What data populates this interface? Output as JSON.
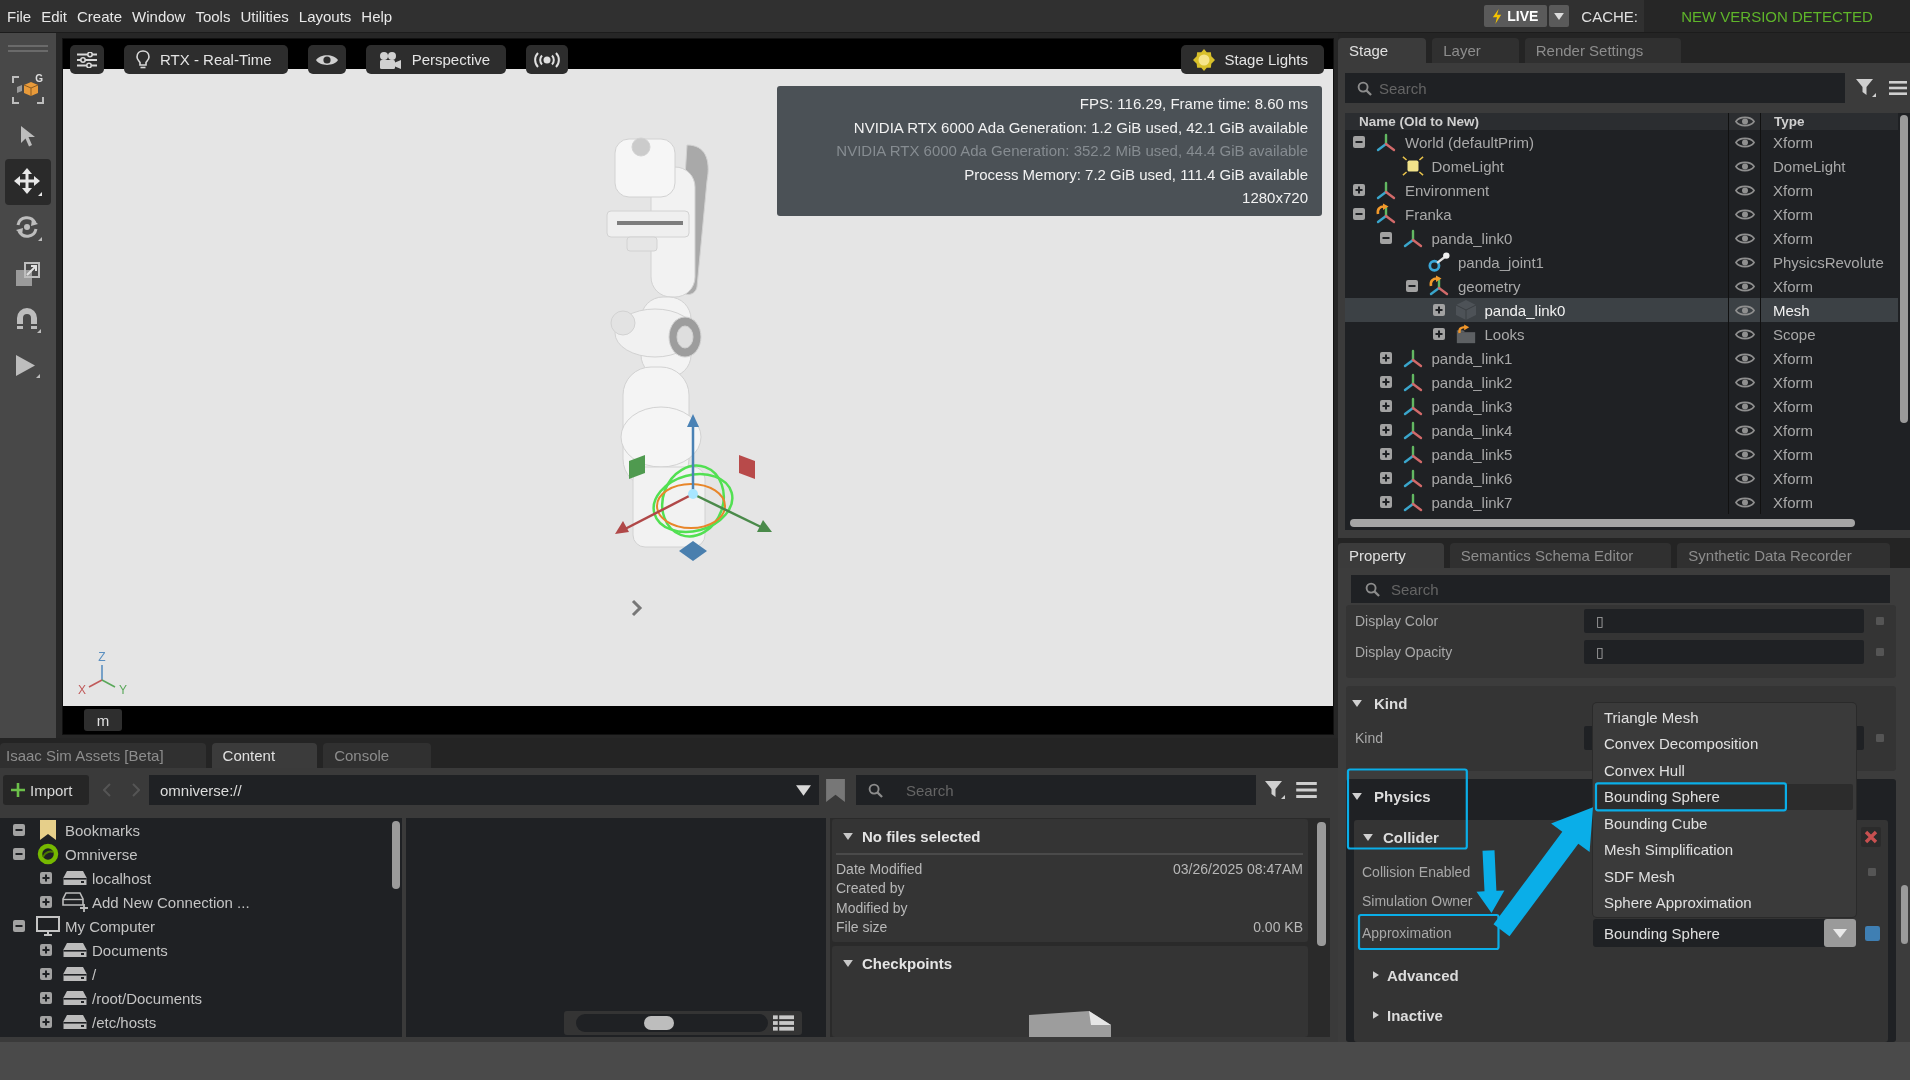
{
  "menu_bar": {
    "items": [
      "File",
      "Edit",
      "Create",
      "Window",
      "Tools",
      "Utilities",
      "Layouts",
      "Help"
    ],
    "live_label": "LIVE",
    "cache_label": "CACHE:",
    "cache_status": "NEW VERSION DETECTED"
  },
  "left_toolbar": {
    "tools": [
      {
        "kind": "select-mode",
        "letter": "G",
        "selected": false
      },
      {
        "kind": "pointer",
        "selected": false
      },
      {
        "kind": "move",
        "selected": true
      },
      {
        "kind": "rotate",
        "selected": false
      },
      {
        "kind": "scale",
        "selected": false
      },
      {
        "kind": "snap",
        "selected": false
      },
      {
        "kind": "play",
        "selected": false
      }
    ]
  },
  "viewport": {
    "toolbar": [
      {
        "kind": "settings"
      },
      {
        "kind": "renderer",
        "label": "RTX - Real-Time"
      },
      {
        "kind": "visibility"
      },
      {
        "kind": "camera",
        "label": "Perspective"
      },
      {
        "kind": "broadcast"
      },
      {
        "kind": "lights",
        "label": "Stage Lights"
      }
    ],
    "stats": [
      {
        "text": "FPS: 116.29, Frame time: 8.60 ms",
        "dimmed": false
      },
      {
        "text": "NVIDIA RTX 6000 Ada Generation: 1.2 GiB used, 42.1 GiB available",
        "dimmed": false
      },
      {
        "text": "NVIDIA RTX 6000 Ada Generation: 352.2 MiB used, 44.4 GiB available",
        "dimmed": true
      },
      {
        "text": "Process Memory: 7.2 GiB used, 111.4 GiB available",
        "dimmed": false
      },
      {
        "text": "1280x720",
        "dimmed": false
      }
    ],
    "axis_labels": [
      "Z",
      "X",
      "Y"
    ],
    "units": "m"
  },
  "stage_panel": {
    "tabs": [
      {
        "label": "Stage",
        "selected": true
      },
      {
        "label": "Layer",
        "selected": false
      },
      {
        "label": "Render Settings",
        "selected": false
      }
    ],
    "search": {
      "placeholder": "Search"
    },
    "columns": {
      "name": "Name (Old to New)",
      "type": "Type"
    },
    "tree": [
      {
        "name": "World (defaultPrim)",
        "type": "Xform",
        "kind": "xform",
        "expanded": true,
        "selected": false,
        "children": [
          {
            "name": "DomeLight",
            "type": "DomeLight",
            "kind": "light",
            "selected": false
          }
        ]
      },
      {
        "name": "Environment",
        "type": "Xform",
        "kind": "xform",
        "expanded": false,
        "selected": false
      },
      {
        "name": "Franka",
        "type": "Xform",
        "kind": "xform-ref",
        "expanded": true,
        "selected": false,
        "children": [
          {
            "name": "panda_link0",
            "type": "Xform",
            "kind": "xform",
            "expanded": true,
            "selected": false,
            "children": [
              {
                "name": "panda_joint1",
                "type": "PhysicsRevolute",
                "kind": "joint",
                "selected": false
              },
              {
                "name": "geometry",
                "type": "Xform",
                "kind": "xform-ref",
                "expanded": true,
                "selected": false,
                "children": [
                  {
                    "name": "panda_link0",
                    "type": "Mesh",
                    "kind": "mesh",
                    "expanded": false,
                    "selected": true
                  },
                  {
                    "name": "Looks",
                    "type": "Scope",
                    "kind": "scope-ref",
                    "expanded": false,
                    "selected": false
                  }
                ]
              }
            ]
          },
          {
            "name": "panda_link1",
            "type": "Xform",
            "kind": "xform",
            "expanded": false,
            "selected": false
          },
          {
            "name": "panda_link2",
            "type": "Xform",
            "kind": "xform",
            "expanded": false,
            "selected": false
          },
          {
            "name": "panda_link3",
            "type": "Xform",
            "kind": "xform",
            "expanded": false,
            "selected": false
          },
          {
            "name": "panda_link4",
            "type": "Xform",
            "kind": "xform",
            "expanded": false,
            "selected": false
          },
          {
            "name": "panda_link5",
            "type": "Xform",
            "kind": "xform",
            "expanded": false,
            "selected": false
          },
          {
            "name": "panda_link6",
            "type": "Xform",
            "kind": "xform",
            "expanded": false,
            "selected": false
          },
          {
            "name": "panda_link7",
            "type": "Xform",
            "kind": "xform",
            "expanded": false,
            "selected": false
          }
        ]
      }
    ]
  },
  "property_panel": {
    "tabs": [
      {
        "label": "Property",
        "selected": true
      },
      {
        "label": "Semantics Schema Editor",
        "selected": false
      },
      {
        "label": "Synthetic Data Recorder",
        "selected": false
      }
    ],
    "search": {
      "placeholder": "Search"
    },
    "rows": [
      {
        "label": "Display Color",
        "kind": "field",
        "value": "▯",
        "modified": false
      },
      {
        "label": "Display Opacity",
        "kind": "field",
        "value": "▯",
        "modified": false
      }
    ],
    "sections": [
      {
        "title": "Kind",
        "expanded": true,
        "highlighted": false,
        "rows": [
          {
            "label": "Kind",
            "kind": "field",
            "modified": false
          }
        ]
      },
      {
        "title": "Physics",
        "expanded": true,
        "highlighted": true,
        "subsections": [
          {
            "title": "Collider",
            "expanded": true,
            "highlighted": true,
            "removable": true,
            "rows": [
              {
                "label": "Collision Enabled",
                "highlighted": false,
                "modified": false
              },
              {
                "label": "Simulation Owner",
                "highlighted": false
              },
              {
                "label": "Approximation",
                "kind": "dropdown",
                "value": "Bounding Sphere",
                "highlighted": true,
                "modified": true
              }
            ],
            "subsections": [
              {
                "title": "Advanced",
                "expanded": false,
                "highlighted": false
              },
              {
                "title": "Inactive",
                "expanded": false,
                "highlighted": false
              }
            ]
          }
        ]
      }
    ],
    "dropdown_menu": {
      "options": [
        {
          "label": "Triangle Mesh",
          "selected": false,
          "highlighted": false
        },
        {
          "label": "Convex Decomposition",
          "selected": false,
          "highlighted": false
        },
        {
          "label": "Convex Hull",
          "selected": false,
          "highlighted": false
        },
        {
          "label": "Bounding Sphere",
          "selected": true,
          "highlighted": true
        },
        {
          "label": "Bounding Cube",
          "selected": false,
          "highlighted": false
        },
        {
          "label": "Mesh Simplification",
          "selected": false,
          "highlighted": false
        },
        {
          "label": "SDF Mesh",
          "selected": false,
          "highlighted": false
        },
        {
          "label": "Sphere Approximation",
          "selected": false,
          "highlighted": false
        }
      ]
    }
  },
  "content_panel": {
    "tabs": [
      {
        "label": "Isaac Sim Assets [Beta]",
        "selected": false
      },
      {
        "label": "Content",
        "selected": true
      },
      {
        "label": "Console",
        "selected": false
      }
    ],
    "import_label": "Import",
    "nav": [
      {
        "kind": "back",
        "disabled": true
      },
      {
        "kind": "forward",
        "disabled": true
      }
    ],
    "path": "omniverse://",
    "search": {
      "placeholder": "Search"
    },
    "tree": [
      {
        "name": "Bookmarks",
        "kind": "bookmark",
        "expanded": true,
        "selected": false
      },
      {
        "name": "Omniverse",
        "kind": "omniverse",
        "expanded": true,
        "selected": false,
        "children": [
          {
            "name": "localhost",
            "kind": "drive",
            "expanded": false,
            "selected": false
          },
          {
            "name": "Add New Connection ...",
            "kind": "add-connection",
            "expanded": false,
            "selected": false
          }
        ]
      },
      {
        "name": "My Computer",
        "kind": "computer",
        "expanded": true,
        "selected": false,
        "children": [
          {
            "name": "Documents",
            "kind": "drive",
            "expanded": false,
            "selected": false
          },
          {
            "name": "/",
            "kind": "drive",
            "expanded": false,
            "selected": false
          },
          {
            "name": "/root/Documents",
            "kind": "drive",
            "expanded": false,
            "selected": false
          },
          {
            "name": "/etc/hosts",
            "kind": "drive",
            "expanded": false,
            "selected": false
          }
        ]
      }
    ],
    "thumbnail_size": {
      "level": 0.42
    },
    "details": {
      "title": "No files selected",
      "expanded": true,
      "rows": [
        {
          "label": "Date Modified",
          "value": "03/26/2025 08:47AM"
        },
        {
          "label": "Created by"
        },
        {
          "label": "Modified by"
        },
        {
          "label": "File size",
          "value": "0.00 KB"
        }
      ]
    },
    "checkpoints": {
      "title": "Checkpoints",
      "expanded": true
    }
  }
}
